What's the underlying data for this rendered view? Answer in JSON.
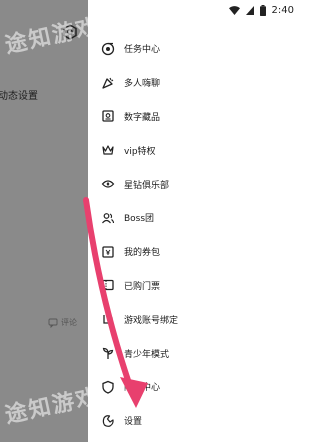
{
  "status_bar": {
    "time": "2:40"
  },
  "background_page": {
    "title": "动态设置",
    "comment_label": "评论"
  },
  "watermark": {
    "text": "途知游戏"
  },
  "menu": {
    "items": [
      {
        "id": "task-center",
        "label": "任务中心",
        "icon": "target-icon"
      },
      {
        "id": "multi-chat",
        "label": "多人嗨聊",
        "icon": "party-icon"
      },
      {
        "id": "digital-collection",
        "label": "数字藏品",
        "icon": "collection-icon"
      },
      {
        "id": "vip",
        "label": "vip特权",
        "icon": "crown-icon"
      },
      {
        "id": "star-diamond",
        "label": "星钻俱乐部",
        "icon": "diamond-icon"
      },
      {
        "id": "boss",
        "label": "Boss团",
        "icon": "group-icon"
      },
      {
        "id": "coupons",
        "label": "我的券包",
        "icon": "coupon-icon"
      },
      {
        "id": "tickets",
        "label": "已购门票",
        "icon": "ticket-icon"
      },
      {
        "id": "account-binding",
        "label": "游戏账号绑定",
        "icon": "link-icon"
      },
      {
        "id": "teen-mode",
        "label": "青少年模式",
        "icon": "sprout-icon"
      },
      {
        "id": "privacy",
        "label": "隐私中心",
        "icon": "shield-icon"
      },
      {
        "id": "settings",
        "label": "设置",
        "icon": "settings-icon"
      }
    ]
  },
  "colors": {
    "scrim": "#8a8a8a",
    "arrow": "#e8406e",
    "text": "#1c1c1c"
  }
}
